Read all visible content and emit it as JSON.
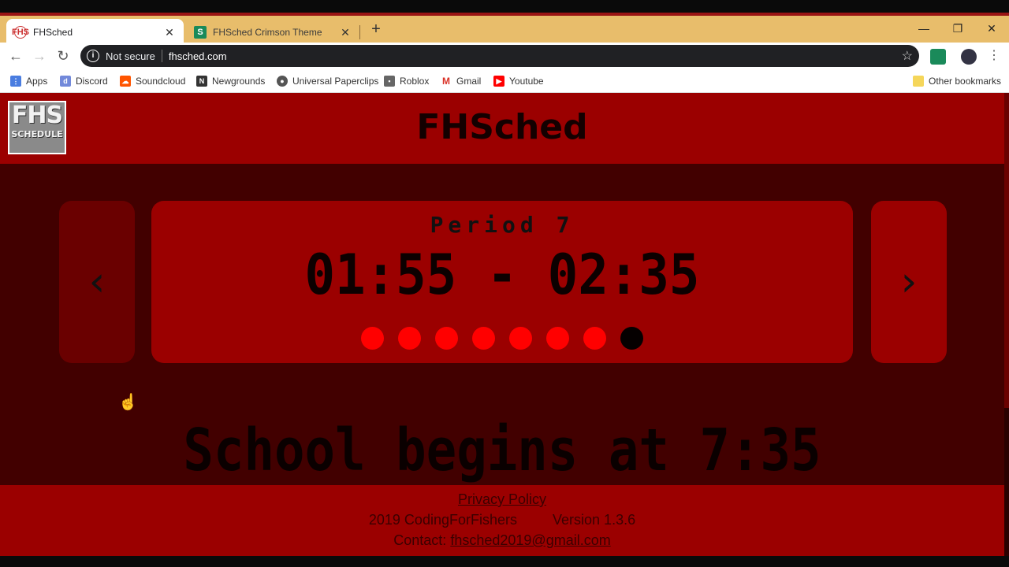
{
  "browser": {
    "tabs": [
      {
        "title": "FHSched",
        "active": true
      },
      {
        "title": "FHSched Crimson Theme",
        "active": false
      }
    ],
    "security_label": "Not secure",
    "url": "fhsched.com",
    "bookmarks": [
      {
        "label": "Apps",
        "icon": "apps-grid-icon"
      },
      {
        "label": "Discord",
        "icon": "discord-icon"
      },
      {
        "label": "Soundcloud",
        "icon": "soundcloud-icon"
      },
      {
        "label": "Newgrounds",
        "icon": "newgrounds-icon"
      },
      {
        "label": "Universal Paperclips",
        "icon": "globe-icon"
      },
      {
        "label": "Roblox",
        "icon": "roblox-icon"
      },
      {
        "label": "Gmail",
        "icon": "gmail-icon"
      },
      {
        "label": "Youtube",
        "icon": "youtube-icon"
      }
    ],
    "other_bookmarks": "Other bookmarks"
  },
  "site": {
    "logo_top": "FHS",
    "logo_bottom": "SCHEDULE",
    "title": "FHSched",
    "period_label": "Period 7",
    "time_range": "01:55 - 02:35",
    "period_count": 8,
    "current_period_index": 7,
    "prev_arrow": "‹",
    "next_arrow": "›",
    "school_begins": "School begins at 7:35",
    "footer": {
      "privacy": "Privacy Policy",
      "copyright": "2019 CodingForFishers",
      "version": "Version 1.3.6",
      "contact_label": "Contact:",
      "contact_email": "fhsched2019@gmail.com"
    }
  },
  "colors": {
    "header": "#9b0000",
    "background": "#420000",
    "dot_active": "#ff0000",
    "dot_current": "#050000"
  }
}
